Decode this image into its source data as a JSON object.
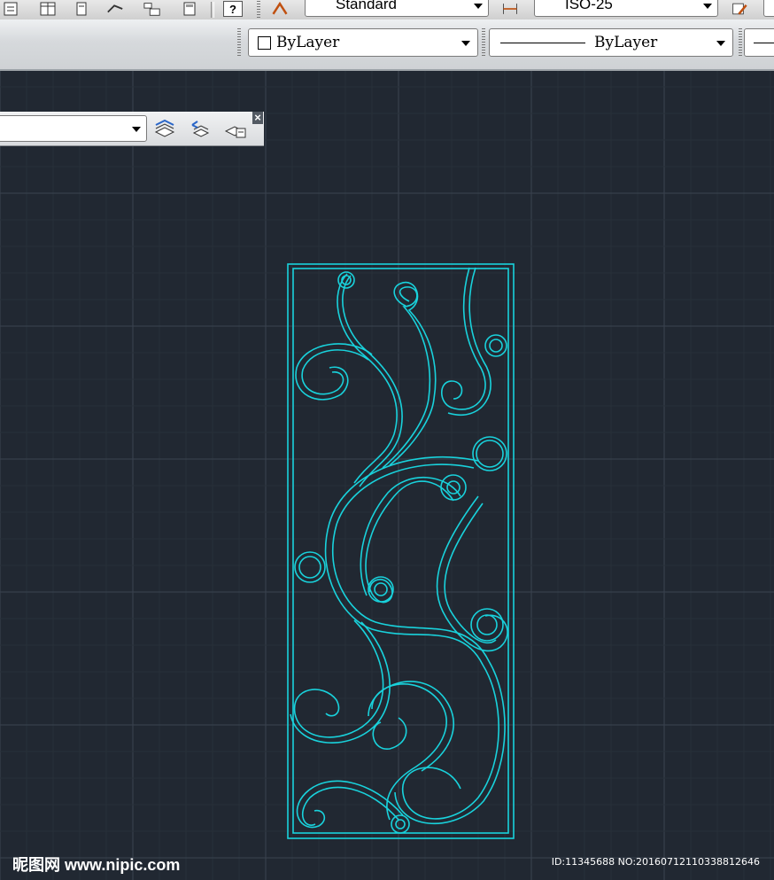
{
  "toolbar_top": {
    "text_style_value": "Standard",
    "dim_style_value": "ISO-25",
    "help_icon": "help-icon"
  },
  "toolbar_properties": {
    "color_value": "ByLayer",
    "linetype_value": "ByLayer"
  },
  "layer_panel": {
    "layer_value": "",
    "close_label": "×"
  },
  "watermark": {
    "site": "昵图网 www.nipic.com",
    "id": "ID:11345688 NO:20160712110338812646"
  },
  "colors": {
    "canvas": "#212832",
    "grid_major": "#3a4350",
    "grid_minor": "#283039",
    "drawing": "#19d2dc"
  }
}
